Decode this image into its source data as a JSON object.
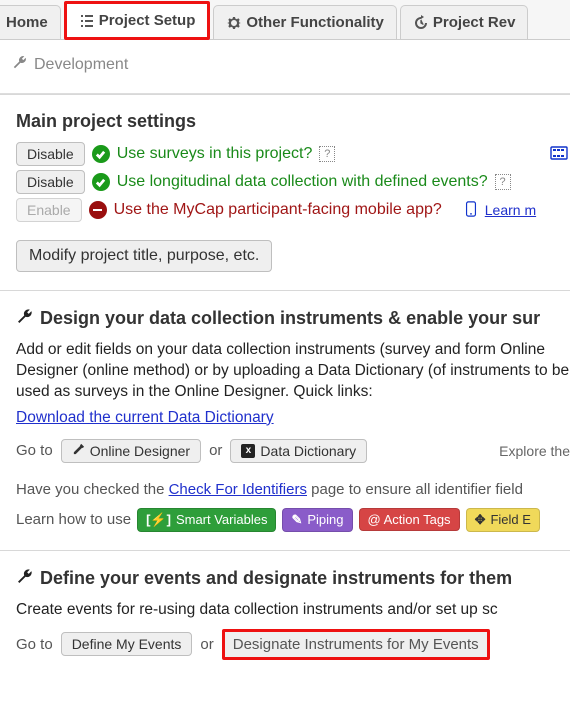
{
  "tabs": {
    "home": "Home",
    "project_setup": "Project Setup",
    "other_func": "Other Functionality",
    "project_rev": "Project Rev"
  },
  "dev_label": "Development",
  "main_settings": {
    "heading": "Main project settings",
    "disable_btn": "Disable",
    "enable_btn": "Enable",
    "surveys_text": "Use surveys in this project?",
    "longitudinal_text": "Use longitudinal data collection with defined events?",
    "mycap_text": "Use the MyCap participant-facing mobile app?",
    "learn_more": "Learn m",
    "modify_btn": "Modify project title, purpose, etc."
  },
  "design": {
    "heading": "Design your data collection instruments & enable your sur",
    "body": "Add or edit fields on your data collection instruments (survey and form Online Designer (online method) or by uploading a Data Dictionary (of instruments to be used as surveys in the Online Designer. Quick links:",
    "download_link": "Download the current Data Dictionary",
    "goto": "Go to",
    "online_designer": "Online Designer",
    "or": "or",
    "data_dictionary": "Data Dictionary",
    "explore": "Explore the",
    "identifiers_pre": "Have you checked the ",
    "identifiers_link": "Check For Identifiers",
    "identifiers_post": " page to ensure all identifier field",
    "learn_how": "Learn how to use",
    "chip_smart": "Smart Variables",
    "chip_piping": "Piping",
    "chip_action": "@ Action Tags",
    "chip_field": "Field E"
  },
  "events": {
    "heading": "Define your events and designate instruments for them",
    "body": "Create events for re-using data collection instruments and/or set up sc",
    "goto": "Go to",
    "define": "Define My Events",
    "or": "or",
    "designate": "Designate Instruments for My Events"
  }
}
